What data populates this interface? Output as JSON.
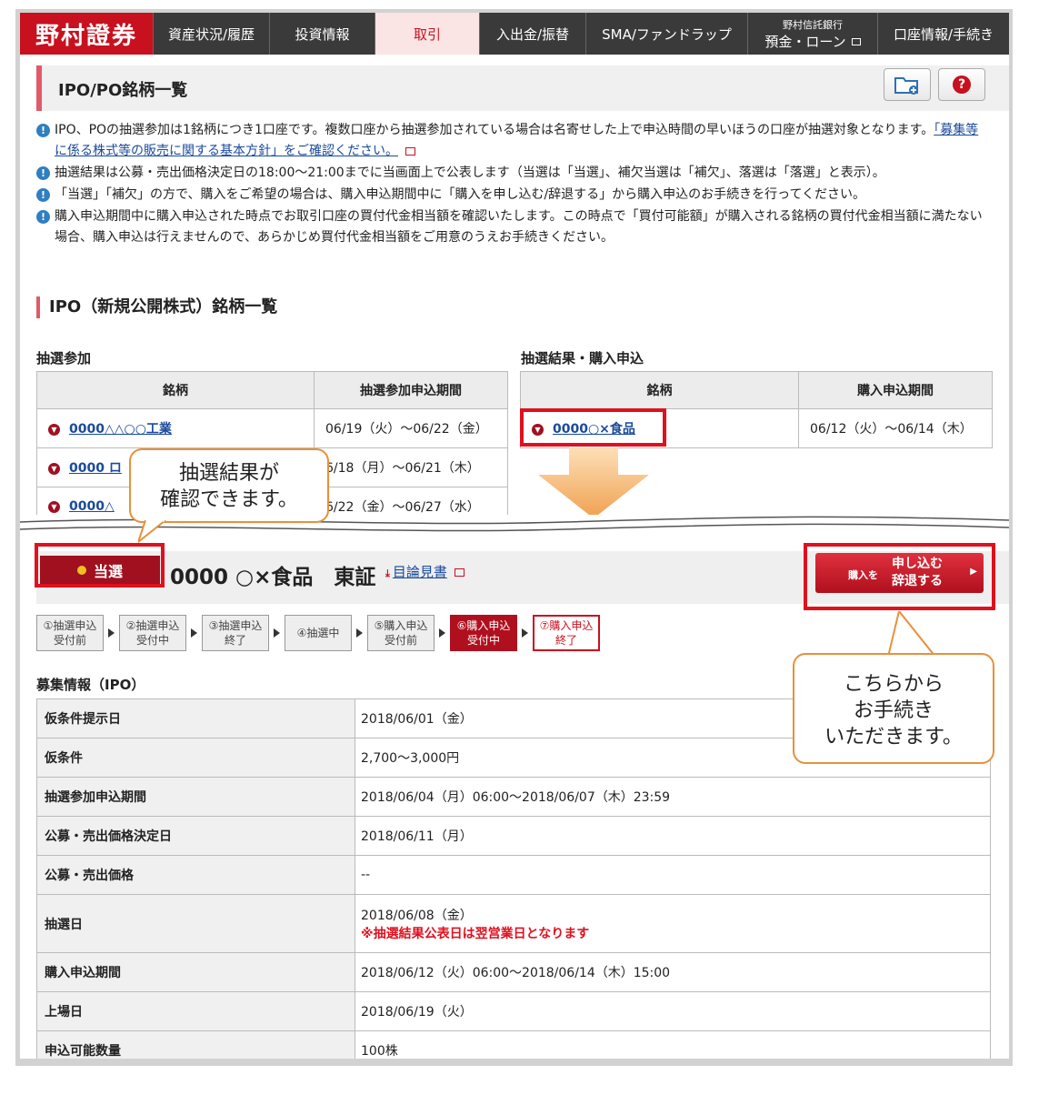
{
  "nav": {
    "logo": "野村證券",
    "items": [
      "資産状況/履歴",
      "投資情報",
      "取引",
      "入出金/振替",
      "SMA/ファンドラップ"
    ],
    "bank_small": "野村信託銀行",
    "bank_label": "預金・ローン",
    "account": "口座情報/手続き"
  },
  "page": {
    "title": "IPO/PO銘柄一覧"
  },
  "notes": {
    "n1a": "IPO、POの抽選参加は1銘柄につき1口座です。複数口座から抽選参加されている場合は名寄せした上で申込時間の早いほうの口座が抽選対象となります。",
    "n1link": "「募集等に係る株式等の販売に関する基本方針」をご確認ください。",
    "n2": "抽選結果は公募・売出価格決定日の18:00～21:00までに当画面上で公表します（当選は「当選」、補欠当選は「補欠」、落選は「落選」と表示）。",
    "n3": "「当選」「補欠」の方で、購入をご希望の場合は、購入申込期間中に「購入を申し込む/辞退する」から購入申込のお手続きを行ってください。",
    "n4": "購入申込期間中に購入申込された時点でお取引口座の買付代金相当額を確認いたします。この時点で「買付可能額」が購入される銘柄の買付代金相当額に満たない場合、購入申込は行えませんので、あらかじめ買付代金相当額をご用意のうえお手続きください。"
  },
  "ipo_section": {
    "title": "IPO（新規公開株式）銘柄一覧"
  },
  "lottery": {
    "heading": "抽選参加",
    "col_name": "銘柄",
    "col_period": "抽選参加申込期間",
    "rows": [
      {
        "name": "0000△△○○工業",
        "period": "06/19（火）～06/22（金）"
      },
      {
        "name": "0000 ロ",
        "period": "6/18（月）～06/21（木）"
      },
      {
        "name": "0000△",
        "period": "6/22（金）～06/27（水）"
      }
    ]
  },
  "result": {
    "heading": "抽選結果・購入申込",
    "col_name": "銘柄",
    "col_period": "購入申込期間",
    "rows": [
      {
        "name": "0000○×食品",
        "period": "06/12（火）～06/14（木）"
      }
    ]
  },
  "callouts": {
    "c1_line1": "抽選結果が",
    "c1_line2": "確認できます。",
    "c2_line1": "こちらから",
    "c2_line2": "お手続き",
    "c2_line3": "いただきます。"
  },
  "detail": {
    "badge": "当選",
    "stock_name": "0000 ○×食品　東証",
    "mokuromi": "目論見書",
    "buy_small": "購入を",
    "buy_line1": "申し込む",
    "buy_line2": "辞退する"
  },
  "steps": [
    {
      "l1": "①抽選申込",
      "l2": "受付前"
    },
    {
      "l1": "②抽選申込",
      "l2": "受付中"
    },
    {
      "l1": "③抽選申込",
      "l2": "終了"
    },
    {
      "l1": "④抽選中",
      "l2": ""
    },
    {
      "l1": "⑤購入申込",
      "l2": "受付前"
    },
    {
      "l1": "⑥購入申込",
      "l2": "受付中"
    },
    {
      "l1": "⑦購入申込",
      "l2": "終了"
    }
  ],
  "boshu": {
    "heading": "募集情報（IPO）",
    "rows": [
      {
        "k": "仮条件提示日",
        "v": "2018/06/01（金）"
      },
      {
        "k": "仮条件",
        "v": "2,700～3,000円"
      },
      {
        "k": "抽選参加申込期間",
        "v": "2018/06/04（月）06:00～2018/06/07（木）23:59"
      },
      {
        "k": "公募・売出価格決定日",
        "v": "2018/06/11（月）"
      },
      {
        "k": "公募・売出価格",
        "v": "--"
      },
      {
        "k": "抽選日",
        "v": "2018/06/08（金）",
        "warn": "※抽選結果公表日は翌営業日となります"
      },
      {
        "k": "購入申込期間",
        "v": "2018/06/12（火）06:00～2018/06/14（木）15:00"
      },
      {
        "k": "上場日",
        "v": "2018/06/19（火）"
      },
      {
        "k": "申込可能数量",
        "v": "100株"
      }
    ]
  },
  "colors": {
    "brand": "#c8101e",
    "callout": "#e8903a",
    "highlight": "#e0101e"
  }
}
